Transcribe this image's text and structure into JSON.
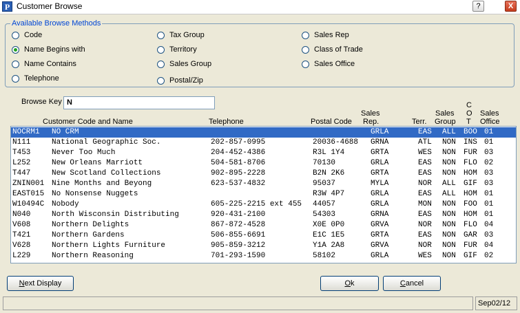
{
  "window": {
    "title": "Customer Browse",
    "app_icon_letter": "P",
    "help_label": "?",
    "close_label": "X"
  },
  "browse_methods": {
    "legend": "Available Browse Methods",
    "options": [
      {
        "label": "Code",
        "checked": false
      },
      {
        "label": "Name Begins with",
        "checked": true
      },
      {
        "label": "Name Contains",
        "checked": false
      },
      {
        "label": "Telephone",
        "checked": false
      },
      {
        "label": "Tax Group",
        "checked": false
      },
      {
        "label": "Territory",
        "checked": false
      },
      {
        "label": "Sales Group",
        "checked": false
      },
      {
        "label": "Postal/Zip",
        "checked": false
      },
      {
        "label": "Sales Rep",
        "checked": false
      },
      {
        "label": "Class of Trade",
        "checked": false
      },
      {
        "label": "Sales Office",
        "checked": false
      }
    ]
  },
  "browse_key": {
    "label": "Browse Key",
    "value": "N"
  },
  "columns": {
    "code_name": "Customer Code and Name",
    "telephone": "Telephone",
    "postal": "Postal Code",
    "sales_rep_1": "Sales",
    "sales_rep_2": "Rep.",
    "terr": "Terr.",
    "sales_group_1": "Sales",
    "sales_group_2": "Group",
    "cot_1": "C",
    "cot_2": "O",
    "cot_3": "T",
    "sales_office_1": "Sales",
    "sales_office_2": "Office"
  },
  "rows": [
    {
      "code": "NOCRM1",
      "name": "NO CRM",
      "phone": "",
      "postal": "",
      "rep": "GRLA",
      "terr": "EAS",
      "group": "ALL",
      "cot": "BOO",
      "office": "01",
      "selected": true
    },
    {
      "code": "N111",
      "name": "National Geographic Soc.",
      "phone": "202-857-0995",
      "postal": "20036-4688",
      "rep": "GRNA",
      "terr": "ATL",
      "group": "NON",
      "cot": "INS",
      "office": "01",
      "selected": false
    },
    {
      "code": "T453",
      "name": "Never Too Much",
      "phone": "204-452-4386",
      "postal": "R3L 1Y4",
      "rep": "GRTA",
      "terr": "WES",
      "group": "NON",
      "cot": "FUR",
      "office": "03",
      "selected": false
    },
    {
      "code": "L252",
      "name": "New Orleans Marriott",
      "phone": "504-581-8706",
      "postal": "70130",
      "rep": "GRLA",
      "terr": "EAS",
      "group": "NON",
      "cot": "FLO",
      "office": "02",
      "selected": false
    },
    {
      "code": "T447",
      "name": "New Scotland Collections",
      "phone": "902-895-2228",
      "postal": "B2N 2K6",
      "rep": "GRTA",
      "terr": "EAS",
      "group": "NON",
      "cot": "HOM",
      "office": "03",
      "selected": false
    },
    {
      "code": "ZNIN001",
      "name": "Nine Months and Beyong",
      "phone": "623-537-4832",
      "postal": "95037",
      "rep": "MYLA",
      "terr": "NOR",
      "group": "ALL",
      "cot": "GIF",
      "office": "03",
      "selected": false
    },
    {
      "code": "EAST015",
      "name": "No Nonsense Nuggets",
      "phone": "",
      "postal": "R3W 4P7",
      "rep": "GRLA",
      "terr": "EAS",
      "group": "ALL",
      "cot": "HOM",
      "office": "01",
      "selected": false
    },
    {
      "code": "W10494C",
      "name": "Nobody",
      "phone": "605-225-2215 ext 455",
      "postal": "44057",
      "rep": "GRLA",
      "terr": "MON",
      "group": "NON",
      "cot": "FOO",
      "office": "01",
      "selected": false
    },
    {
      "code": "N040",
      "name": "North Wisconsin Distributing",
      "phone": "920-431-2100",
      "postal": "54303",
      "rep": "GRNA",
      "terr": "EAS",
      "group": "NON",
      "cot": "HOM",
      "office": "01",
      "selected": false
    },
    {
      "code": "V608",
      "name": "Northern Delights",
      "phone": "867-872-4528",
      "postal": "X0E 0P0",
      "rep": "GRVA",
      "terr": "NOR",
      "group": "NON",
      "cot": "FLO",
      "office": "04",
      "selected": false
    },
    {
      "code": "T421",
      "name": "Northern Gardens",
      "phone": "506-855-6691",
      "postal": "E1C 1E5",
      "rep": "GRTA",
      "terr": "EAS",
      "group": "NON",
      "cot": "GAR",
      "office": "03",
      "selected": false
    },
    {
      "code": "V628",
      "name": "Northern Lights Furniture",
      "phone": "905-859-3212",
      "postal": "Y1A 2A8",
      "rep": "GRVA",
      "terr": "NOR",
      "group": "NON",
      "cot": "FUR",
      "office": "04",
      "selected": false
    },
    {
      "code": "L229",
      "name": "Northern Reasoning",
      "phone": "701-293-1590",
      "postal": "58102",
      "rep": "GRLA",
      "terr": "WES",
      "group": "NON",
      "cot": "GIF",
      "office": "02",
      "selected": false
    }
  ],
  "buttons": {
    "next_display": {
      "u": "N",
      "rest": "ext Display"
    },
    "ok": {
      "u": "O",
      "rest": "k"
    },
    "cancel": {
      "u": "C",
      "rest": "ancel"
    }
  },
  "status": {
    "message": "",
    "date": "Sep02/12"
  }
}
